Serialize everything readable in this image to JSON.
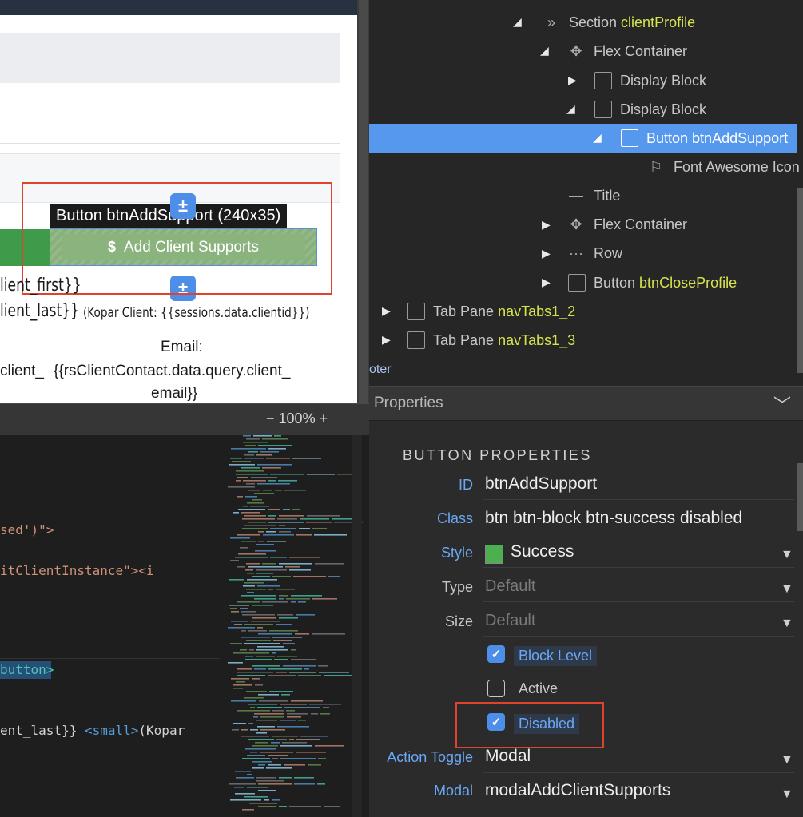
{
  "canvas": {
    "tooltip": "Button btnAddSupport (240x35)",
    "button_icon": "$",
    "button_label": "Add Client Supports",
    "handle_symbol": "±",
    "text_first": "lient_first}}",
    "text_last": "lient_last}}",
    "text_kopar": "(Kopar Client: {{sessions.data.clientid}})",
    "email_label": "Email:",
    "email_frag1": "client_",
    "email_frag2": "{{rsClientContact.data.query.client_",
    "email_frag3": "email}}"
  },
  "zoom": {
    "minus": "−",
    "value": "100%",
    "plus": "+"
  },
  "code": {
    "line1": "sed')\">",
    "line2a": "itClientInstance\"><i",
    "line3": "button>",
    "line4a": "ent_last}} ",
    "line4b": "<small>",
    "line4c": "(Kopar"
  },
  "tree": {
    "nodes": [
      {
        "label": "Section",
        "name": "clientProfile"
      },
      {
        "label": "Flex Container",
        "name": ""
      },
      {
        "label": "Display Block",
        "name": ""
      },
      {
        "label": "Display Block",
        "name": ""
      },
      {
        "label": "Button",
        "name": "btnAddSupport"
      },
      {
        "label": "Font Awesome Icon",
        "name": ""
      },
      {
        "label": "Title",
        "name": ""
      },
      {
        "label": "Flex Container",
        "name": ""
      },
      {
        "label": "Row",
        "name": ""
      },
      {
        "label": "Button",
        "name": "btnCloseProfile"
      },
      {
        "label": "Tab Pane",
        "name": "navTabs1_2"
      },
      {
        "label": "Tab Pane",
        "name": "navTabs1_3"
      }
    ],
    "footer_fragment": "oter"
  },
  "properties": {
    "header": "Properties",
    "section_title": "BUTTON PROPERTIES",
    "id_label": "ID",
    "id_value": "btnAddSupport",
    "class_label": "Class",
    "class_value": "btn btn-block btn-success disabled",
    "style_label": "Style",
    "style_value": "Success",
    "style_color": "#4caf50",
    "type_label": "Type",
    "type_value": "Default",
    "size_label": "Size",
    "size_value": "Default",
    "block_level": {
      "label": "Block Level",
      "checked": true
    },
    "active": {
      "label": "Active",
      "checked": false
    },
    "disabled": {
      "label": "Disabled",
      "checked": true
    },
    "action_toggle_label": "Action Toggle",
    "action_toggle_value": "Modal",
    "modal_label": "Modal",
    "modal_value": "modalAddClientSupports"
  },
  "colors": {
    "accent": "#4d8fe8",
    "selection": "#5598ee",
    "highlight_box": "#e0432b",
    "success": "#4caf50",
    "tree_name": "#d7e34f"
  }
}
